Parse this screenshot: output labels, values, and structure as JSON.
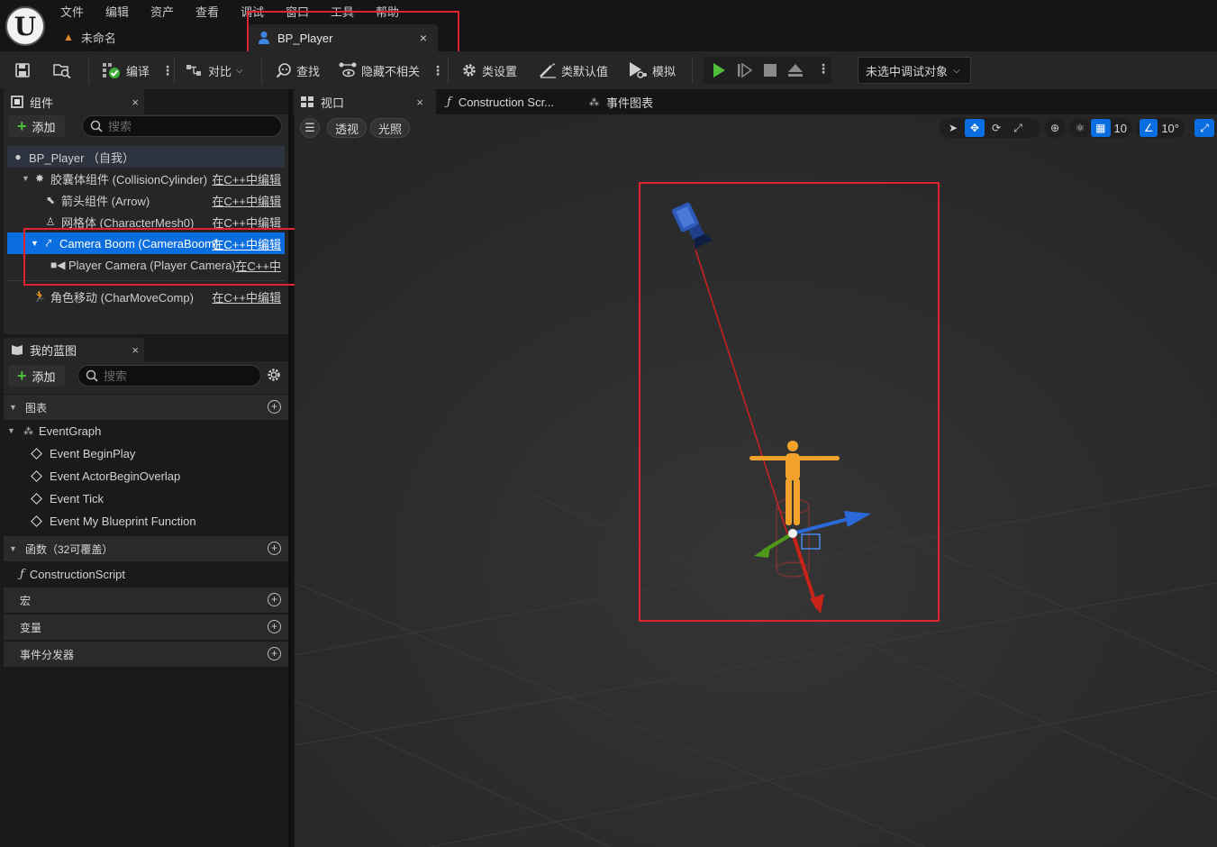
{
  "menu": {
    "items": [
      "文件",
      "编辑",
      "资产",
      "查看",
      "调试",
      "窗口",
      "工具",
      "帮助"
    ]
  },
  "level_tab": {
    "label": "未命名"
  },
  "document_tab": {
    "label": "BP_Player",
    "close": "×"
  },
  "toolbar": {
    "compile": "编译",
    "diff": "对比",
    "find": "查找",
    "hide_unrelated": "隐藏不相关",
    "class_settings": "类设置",
    "class_defaults": "类默认值",
    "simulate": "模拟",
    "debug_object": "未选中调试对象"
  },
  "components_panel": {
    "tab_label": "组件",
    "close": "×",
    "add_label": "添加",
    "search_placeholder": "搜索",
    "items": [
      {
        "label": "BP_Player （自我）",
        "link": ""
      },
      {
        "label": "胶囊体组件 (CollisionCylinder)",
        "link": "在C++中编辑"
      },
      {
        "label": "箭头组件 (Arrow)",
        "link": "在C++中编辑"
      },
      {
        "label": "网格体 (CharacterMesh0)",
        "link": "在C++中编辑"
      },
      {
        "label": "Camera Boom (CameraBoom)",
        "link": "在C++中编辑"
      },
      {
        "label": "Player Camera (Player Camera)",
        "link": "在C++中"
      },
      {
        "label": "角色移动 (CharMoveComp)",
        "link": "在C++中编辑"
      }
    ]
  },
  "my_blueprint_panel": {
    "tab_label": "我的蓝图",
    "close": "×",
    "add_label": "添加",
    "search_placeholder": "搜索",
    "sections": {
      "graphs": "图表",
      "functions": "函数（32可覆盖）",
      "macros": "宏",
      "variables": "变量",
      "dispatchers": "事件分发器"
    },
    "event_graph": "EventGraph",
    "events": [
      "Event BeginPlay",
      "Event ActorBeginOverlap",
      "Event Tick",
      "Event My Blueprint Function"
    ],
    "construction_script": "ConstructionScript"
  },
  "editor_tabs": {
    "viewport": "视口",
    "construction": "Construction Scr...",
    "event_graph": "事件图表",
    "close": "×"
  },
  "viewport": {
    "perspective": "透视",
    "lighting": "光照",
    "grid_snap": "10",
    "rotation_snap": "10°"
  },
  "colors": {
    "accent": "#0b6ee0",
    "highlight_box": "#e0242f",
    "play_green": "#4fbf3b",
    "character": "#f2a22a"
  }
}
